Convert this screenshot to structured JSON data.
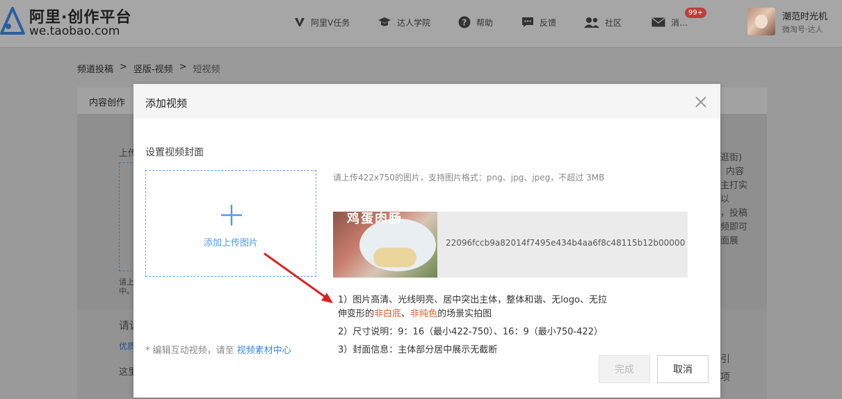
{
  "header": {
    "logo_title": "阿里·创作平台",
    "logo_sub": "we.taobao.com",
    "nav": [
      {
        "label": "阿里V任务",
        "icon": "v-task-icon"
      },
      {
        "label": "达人学院",
        "icon": "graduation-cap-icon"
      },
      {
        "label": "帮助",
        "icon": "help-icon"
      },
      {
        "label": "反馈",
        "icon": "feedback-icon"
      },
      {
        "label": "社区",
        "icon": "community-icon"
      },
      {
        "label": "消…",
        "icon": "message-icon",
        "badge": "99+"
      }
    ],
    "user": {
      "name": "潮范时光机",
      "subtitle": "微淘号·达人"
    }
  },
  "breadcrumb": [
    "频道投稿",
    "竖版-视频",
    "短视频"
  ],
  "background": {
    "tab": "内容创作",
    "upload_label_partial": "上传",
    "hint_partial": [
      "请上",
      "中。"
    ],
    "section_partial": "请说",
    "link_partial": "优质",
    "text_partial": "这里",
    "right_text": [
      "逛街)",
      "内容",
      "主打实",
      "以",
      "，投稿",
      "频即可",
      "面展"
    ],
    "right_text2": [
      "引",
      "项"
    ]
  },
  "modal": {
    "title": "添加视频",
    "section_title": "设置视频封面",
    "upload_label": "添加上传图片",
    "hint": "请上传422x750的图片，支持图片格式：png、jpg、jpeg，不超过 3MB",
    "thumbnail": {
      "caption": "鸡蛋肉肠",
      "file_name": "22096fccb9a82014f7495e434b4aa6f8c48115b12b00000"
    },
    "rules": {
      "r1_a": "1）图片高清、光线明亮、居中突出主体，整体和谐、无logo、无拉",
      "r1_b_pre": "伸变形的",
      "r1_b_hl1": "非白底",
      "r1_b_sep": "、",
      "r1_b_hl2": "非纯色",
      "r1_b_post": "的场景实拍图",
      "r2": "2）尺寸说明：9：16（最小422-750）、16：9（最小750-422）",
      "r3": "3）封面信息：主体部分居中展示无截断"
    },
    "footnote": "* 编辑互动视频，请至 ",
    "footnote_link": "视频素材中心",
    "done_label": "完成",
    "cancel_label": "取消"
  },
  "colors": {
    "accent": "#4d9be8",
    "highlight": "#e15f24",
    "badge": "#c03b3b",
    "arrow": "#e02020"
  }
}
